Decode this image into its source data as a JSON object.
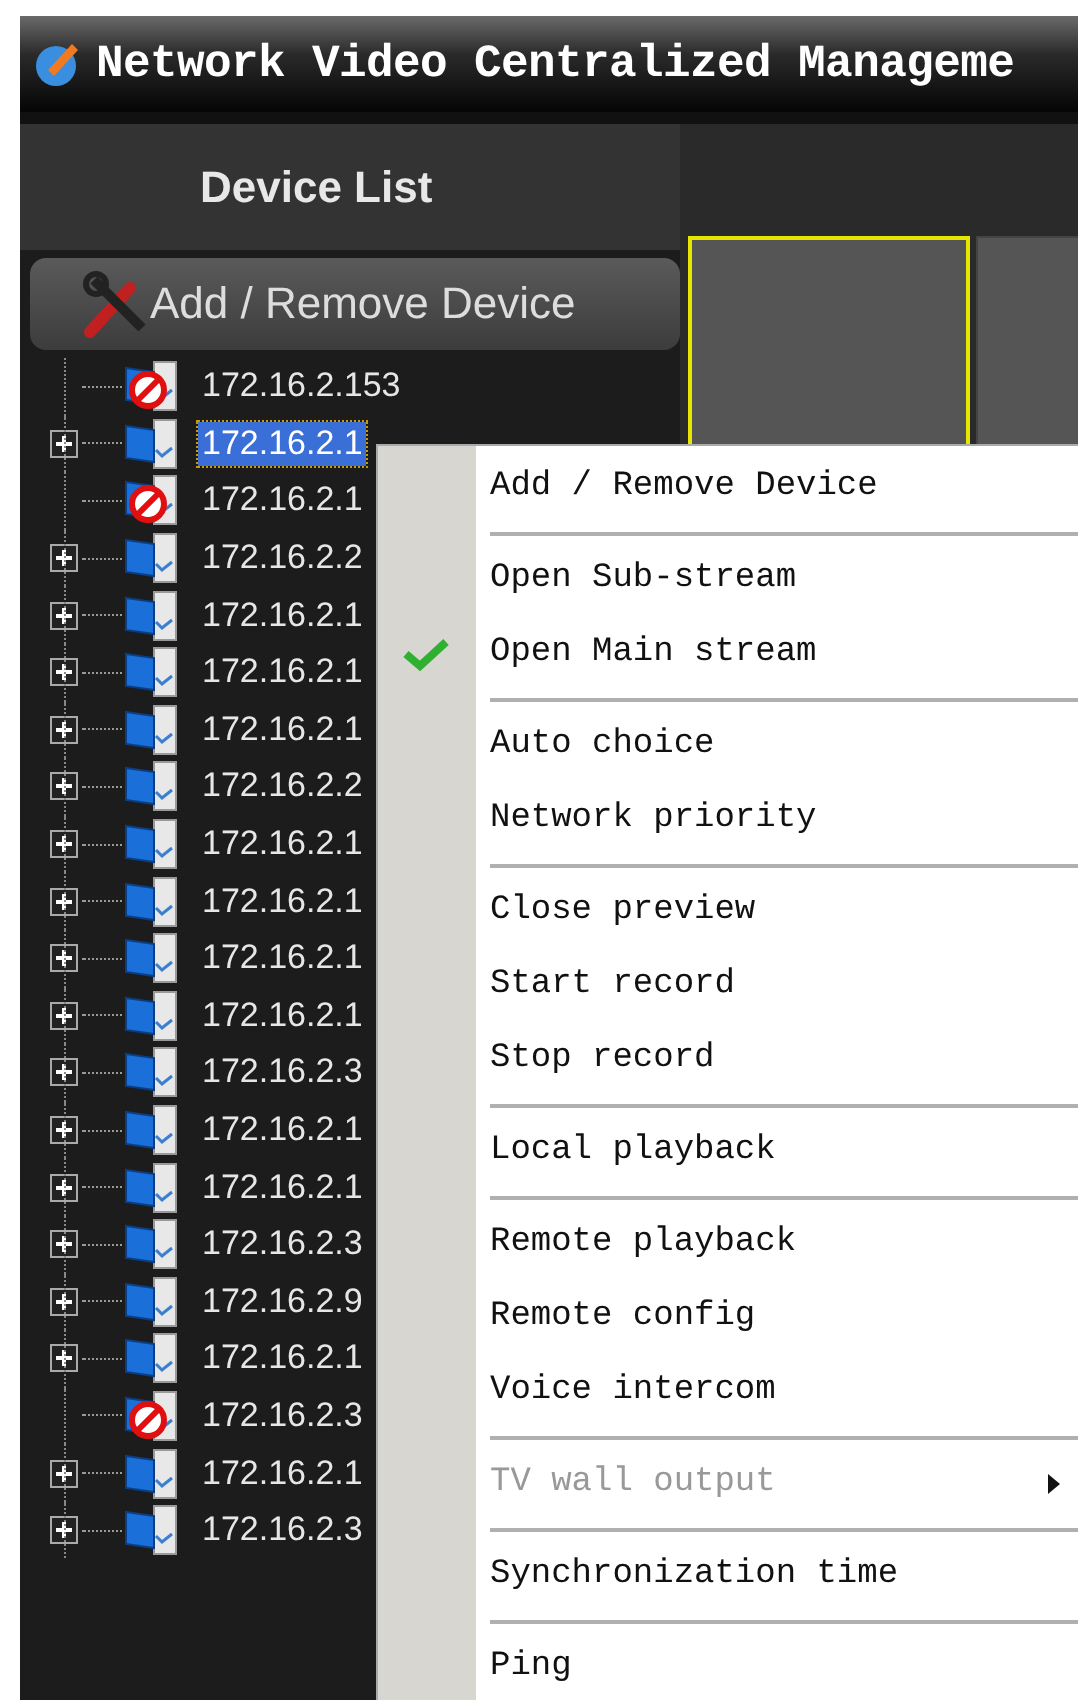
{
  "window": {
    "title": "Network Video Centralized Manageme"
  },
  "sidebar": {
    "header": "Device List",
    "add_button": "Add / Remove Device",
    "devices": [
      {
        "ip": "172.16.2.153",
        "online": false,
        "expandable": false,
        "selected": false
      },
      {
        "ip": "172.16.2.1",
        "online": true,
        "expandable": true,
        "selected": true
      },
      {
        "ip": "172.16.2.1",
        "online": false,
        "expandable": false,
        "selected": false
      },
      {
        "ip": "172.16.2.2",
        "online": true,
        "expandable": true,
        "selected": false
      },
      {
        "ip": "172.16.2.1",
        "online": true,
        "expandable": true,
        "selected": false
      },
      {
        "ip": "172.16.2.1",
        "online": true,
        "expandable": true,
        "selected": false
      },
      {
        "ip": "172.16.2.1",
        "online": true,
        "expandable": true,
        "selected": false
      },
      {
        "ip": "172.16.2.2",
        "online": true,
        "expandable": true,
        "selected": false
      },
      {
        "ip": "172.16.2.1",
        "online": true,
        "expandable": true,
        "selected": false
      },
      {
        "ip": "172.16.2.1",
        "online": true,
        "expandable": true,
        "selected": false
      },
      {
        "ip": "172.16.2.1",
        "online": true,
        "expandable": true,
        "selected": false
      },
      {
        "ip": "172.16.2.1",
        "online": true,
        "expandable": true,
        "selected": false
      },
      {
        "ip": "172.16.2.3",
        "online": true,
        "expandable": true,
        "selected": false
      },
      {
        "ip": "172.16.2.1",
        "online": true,
        "expandable": true,
        "selected": false
      },
      {
        "ip": "172.16.2.1",
        "online": true,
        "expandable": true,
        "selected": false
      },
      {
        "ip": "172.16.2.3",
        "online": true,
        "expandable": true,
        "selected": false
      },
      {
        "ip": "172.16.2.9",
        "online": true,
        "expandable": true,
        "selected": false
      },
      {
        "ip": "172.16.2.1",
        "online": true,
        "expandable": true,
        "selected": false
      },
      {
        "ip": "172.16.2.3",
        "online": false,
        "expandable": false,
        "selected": false
      },
      {
        "ip": "172.16.2.1",
        "online": true,
        "expandable": true,
        "selected": false
      },
      {
        "ip": "172.16.2.3",
        "online": true,
        "expandable": true,
        "selected": false
      }
    ]
  },
  "video_tiles": [
    {
      "selected": true
    },
    {
      "selected": false
    }
  ],
  "context_menu": {
    "items": [
      {
        "kind": "item",
        "label": "Add / Remove Device",
        "checked": false,
        "disabled": false,
        "submenu": false
      },
      {
        "kind": "separator"
      },
      {
        "kind": "item",
        "label": "Open Sub-stream",
        "checked": false,
        "disabled": false,
        "submenu": false
      },
      {
        "kind": "item",
        "label": "Open Main stream",
        "checked": true,
        "disabled": false,
        "submenu": false
      },
      {
        "kind": "separator"
      },
      {
        "kind": "item",
        "label": "Auto choice",
        "checked": false,
        "disabled": false,
        "submenu": false
      },
      {
        "kind": "item",
        "label": "Network priority",
        "checked": false,
        "disabled": false,
        "submenu": false
      },
      {
        "kind": "separator"
      },
      {
        "kind": "item",
        "label": "Close preview",
        "checked": false,
        "disabled": false,
        "submenu": false
      },
      {
        "kind": "item",
        "label": "Start record",
        "checked": false,
        "disabled": false,
        "submenu": false
      },
      {
        "kind": "item",
        "label": "Stop record",
        "checked": false,
        "disabled": false,
        "submenu": false
      },
      {
        "kind": "separator"
      },
      {
        "kind": "item",
        "label": "Local playback",
        "checked": false,
        "disabled": false,
        "submenu": false
      },
      {
        "kind": "separator"
      },
      {
        "kind": "item",
        "label": "Remote playback",
        "checked": false,
        "disabled": false,
        "submenu": false
      },
      {
        "kind": "item",
        "label": "Remote config",
        "checked": false,
        "disabled": false,
        "submenu": false
      },
      {
        "kind": "item",
        "label": "Voice intercom",
        "checked": false,
        "disabled": false,
        "submenu": false
      },
      {
        "kind": "separator"
      },
      {
        "kind": "item",
        "label": "TV wall output",
        "checked": false,
        "disabled": true,
        "submenu": true
      },
      {
        "kind": "separator"
      },
      {
        "kind": "item",
        "label": "Synchronization time",
        "checked": false,
        "disabled": false,
        "submenu": false
      },
      {
        "kind": "separator"
      },
      {
        "kind": "item",
        "label": "Ping",
        "checked": false,
        "disabled": false,
        "submenu": false
      }
    ]
  }
}
